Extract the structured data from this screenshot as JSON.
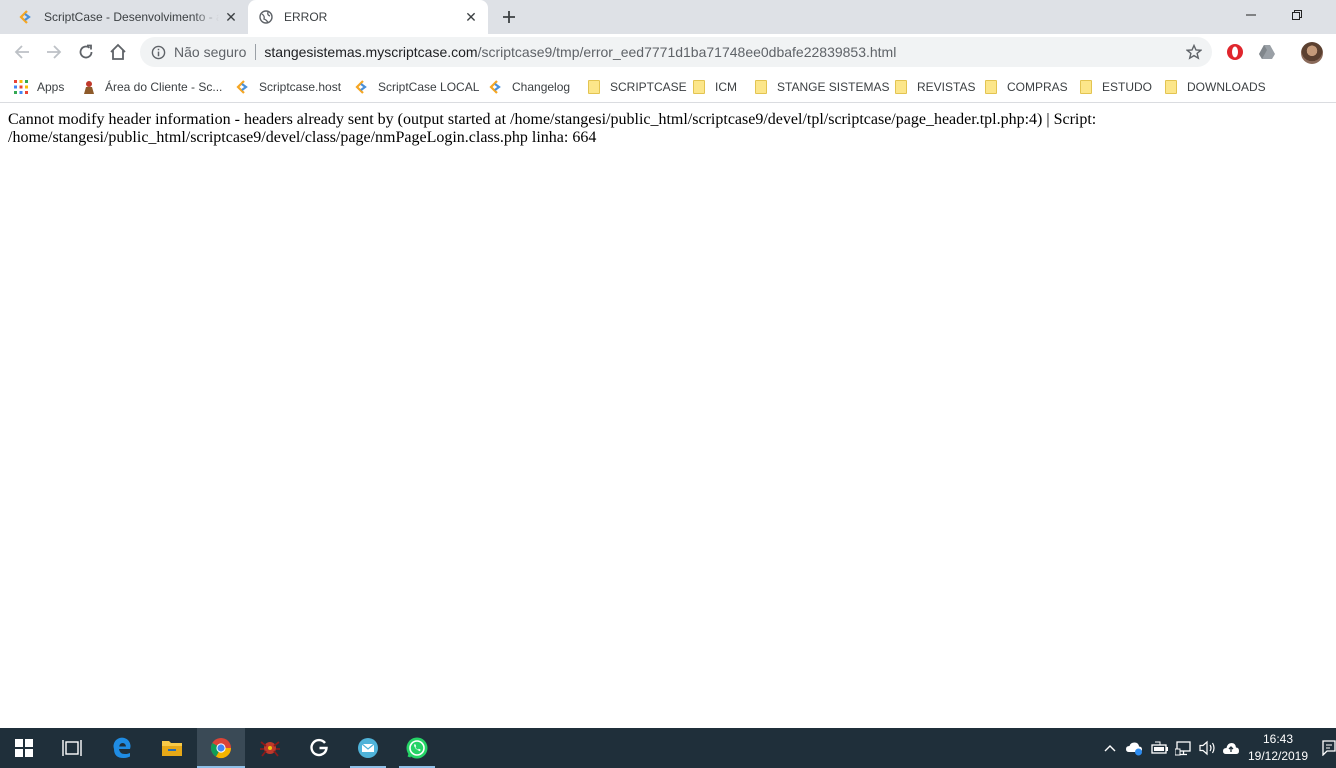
{
  "tabs": [
    {
      "title": "ScriptCase - Desenvolvimento - a",
      "favicon": "scriptcase-icon",
      "active": false
    },
    {
      "title": "ERROR",
      "favicon": "globe-icon",
      "active": true
    }
  ],
  "address_bar": {
    "security_label": "Não seguro",
    "url_host": "stangesistemas.myscriptcase.com",
    "url_path": "/scriptcase9/tmp/error_eed7771d1ba71748ee0dbafe22839853.html"
  },
  "bookmarks": [
    {
      "label": "Apps",
      "icon": "apps-grid-icon"
    },
    {
      "label": "Área do Cliente - Sc...",
      "icon": "client-area-icon"
    },
    {
      "label": "Scriptcase.host",
      "icon": "scriptcase-icon"
    },
    {
      "label": "ScriptCase LOCAL",
      "icon": "scriptcase-icon"
    },
    {
      "label": "Changelog",
      "icon": "scriptcase-icon"
    },
    {
      "label": "SCRIPTCASE",
      "icon": "folder-icon"
    },
    {
      "label": "ICM",
      "icon": "folder-icon"
    },
    {
      "label": "STANGE SISTEMAS",
      "icon": "folder-icon"
    },
    {
      "label": "REVISTAS",
      "icon": "folder-icon"
    },
    {
      "label": "COMPRAS",
      "icon": "folder-icon"
    },
    {
      "label": "ESTUDO",
      "icon": "folder-icon"
    },
    {
      "label": "DOWNLOADS",
      "icon": "folder-icon"
    }
  ],
  "page": {
    "error_message": "Cannot modify header information - headers already sent by (output started at /home/stangesi/public_html/scriptcase9/devel/tpl/scriptcase/page_header.tpl.php:4) | Script: /home/stangesi/public_html/scriptcase9/devel/class/page/nmPageLogin.class.php linha: 664"
  },
  "taskbar": {
    "time": "16:43",
    "date": "19/12/2019"
  }
}
